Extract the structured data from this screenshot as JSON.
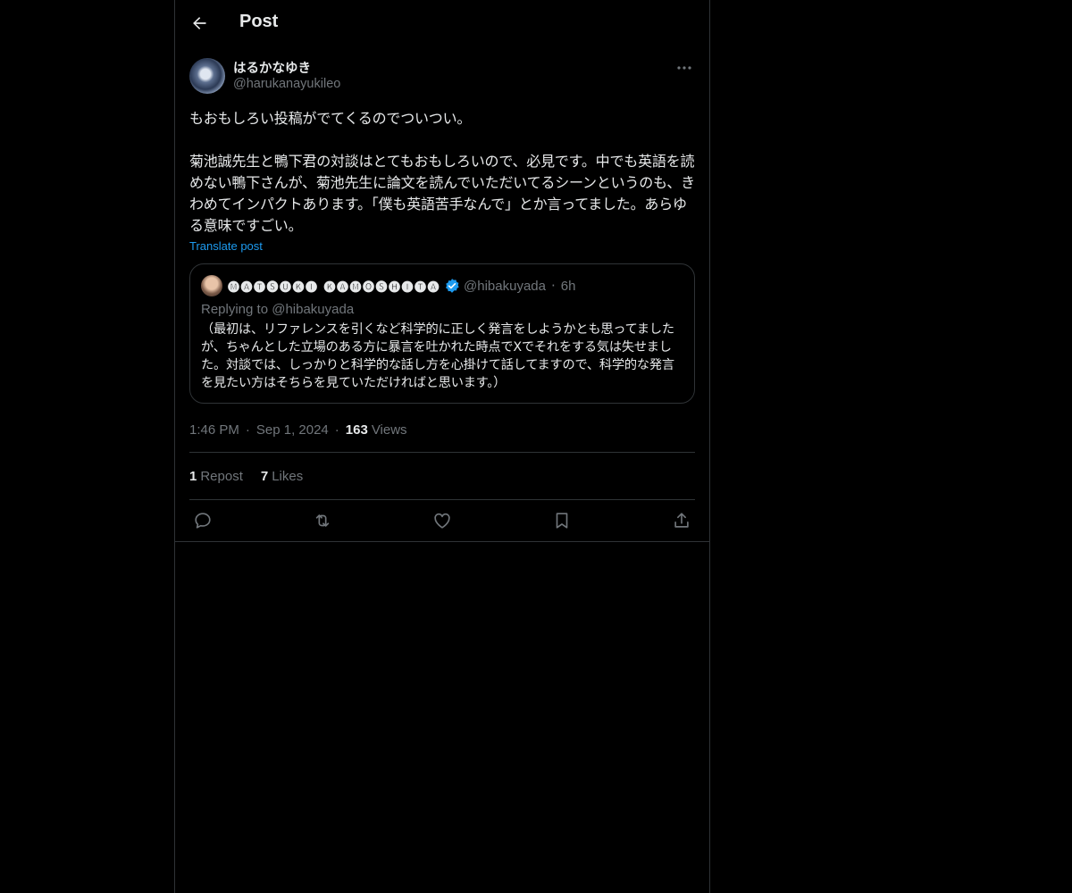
{
  "header": {
    "title": "Post",
    "back_icon": "arrow-left-icon"
  },
  "post": {
    "author_name": "はるかなゆき",
    "author_handle": "@harukanayukileo",
    "text": "もおもしろい投稿がでてくるのでついつい。\n\n菊池誠先生と鴨下君の対談はとてもおもしろいので、必見です。中でも英語を読めない鴨下さんが、菊池先生に論文を読んでいただいてるシーンというのも、きわめてインパクトあります。「僕も英語苦手なんで」とか言ってました。あらゆる意味ですごい。",
    "translate_label": "Translate post",
    "timestamp_time": "1:46 PM",
    "timestamp_date": "Sep 1, 2024",
    "views_count": "163",
    "views_label": "Views",
    "reposts_count": "1",
    "reposts_label": "Repost",
    "likes_count": "7",
    "likes_label": "Likes"
  },
  "quote": {
    "author_name": "🅜🅐🅣🅢🅤🅚🅘 🅚🅐🅜🅞🅢🅗🅘🅣🅐",
    "author_handle": "@hibakuyada",
    "time_ago": "6h",
    "replying_prefix": "Replying to",
    "replying_handle": "@hibakuyada",
    "text": "（最初は、リファレンスを引くなど科学的に正しく発言をしようかとも思ってましたが、ちゃんとした立場のある方に暴言を吐かれた時点でXでそれをする気は失せました。対談では、しっかりと科学的な話し方を心掛けて話してますので、科学的な発言を見たい方はそちらを見ていただければと思います。）",
    "verified_color": "#1d9bf0"
  },
  "actions": [
    "reply-icon",
    "repost-icon",
    "like-icon",
    "bookmark-icon",
    "share-icon"
  ],
  "colors": {
    "background": "#000000",
    "text": "#e7e9ea",
    "muted": "#71767b",
    "accent": "#1d9bf0",
    "border": "#2f3336"
  }
}
